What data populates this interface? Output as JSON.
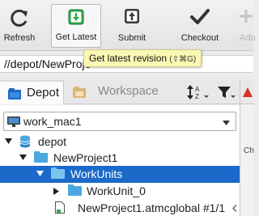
{
  "toolbar": {
    "refresh_label": "Refresh",
    "get_latest_label": "Get Latest",
    "submit_label": "Submit",
    "checkout_label": "Checkout",
    "add_label": "Ado"
  },
  "path": {
    "value": "//depot/NewProje"
  },
  "tooltip": {
    "text": "Get latest revision",
    "shortcut": "(⇧⌘G)"
  },
  "tabs": {
    "depot_label": "Depot",
    "workspace_label": "Workspace"
  },
  "right_panel": {
    "label": "Ch"
  },
  "workspace_select": {
    "value": "work_mac1"
  },
  "tree": {
    "rows": [
      {
        "label": "depot"
      },
      {
        "label": "NewProject1"
      },
      {
        "label": "WorkUnits"
      },
      {
        "label": "WorkUnit_0"
      },
      {
        "label": "NewProject1.atmcglobal",
        "rev": "#1/1"
      }
    ]
  },
  "colors": {
    "selection": "#1b6ac9",
    "tooltip_bg": "#fbf8b4",
    "folder": "#4aa7e0",
    "get_latest_green": "#2faa4c"
  }
}
